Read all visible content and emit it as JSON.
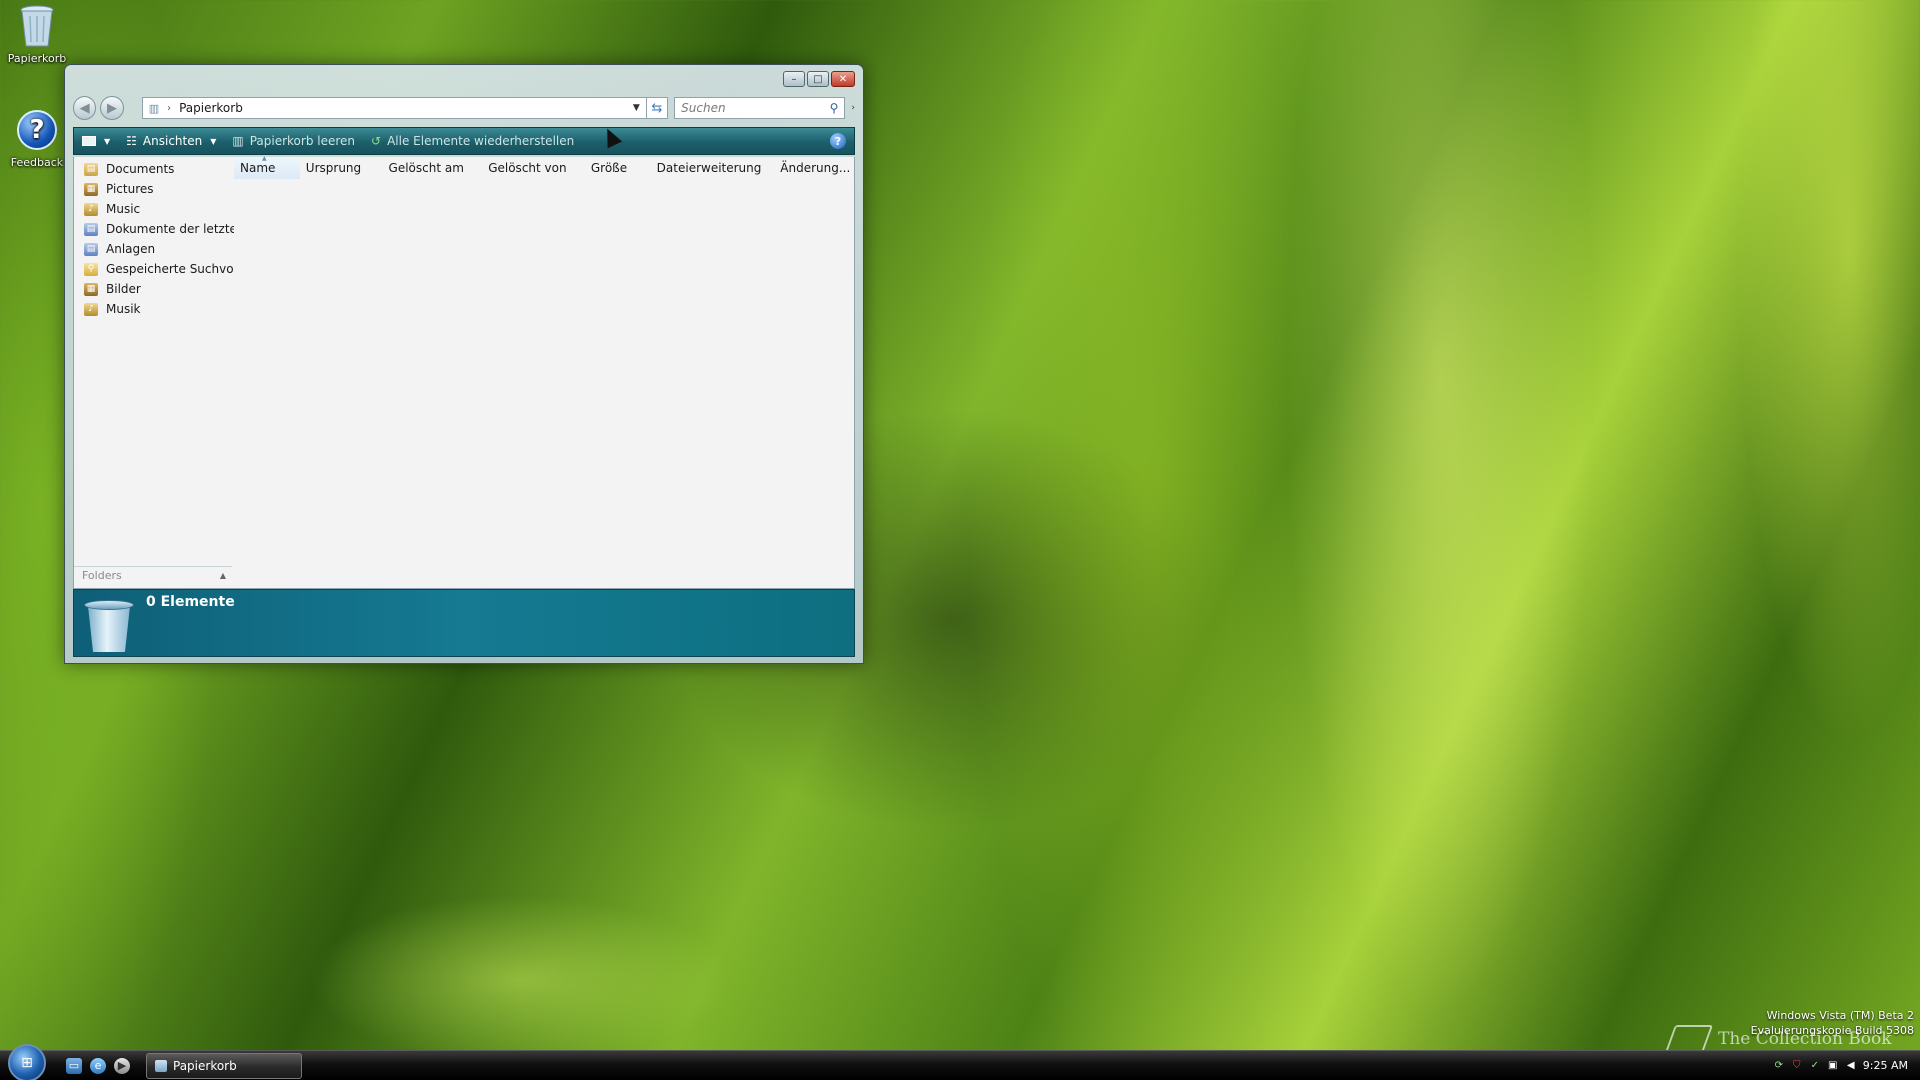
{
  "desktop": {
    "icons": [
      {
        "label": "Papierkorb",
        "icon": "recycle-bin-icon"
      },
      {
        "label": "Feedback",
        "icon": "help-icon"
      }
    ],
    "watermark": {
      "line1": "Windows Vista (TM) Beta 2",
      "line2": "Evaluierungskopie Build 5308"
    },
    "overlay_brand": "The Collection Book"
  },
  "window": {
    "controls": {
      "minimize": "–",
      "maximize": "□",
      "close": "✕"
    },
    "address": {
      "path": "Papierkorb"
    },
    "search": {
      "placeholder": "Suchen"
    },
    "toolbar": {
      "views_label": "Ansichten",
      "empty_label": "Papierkorb leeren",
      "restore_label": "Alle Elemente wiederherstellen",
      "help": "?"
    },
    "favorites": [
      {
        "label": "Documents",
        "icon": "doc"
      },
      {
        "label": "Pictures",
        "icon": "pic"
      },
      {
        "label": "Music",
        "icon": "mus"
      },
      {
        "label": "Dokumente der letzten",
        "icon": "rec"
      },
      {
        "label": "Anlagen",
        "icon": "rec"
      },
      {
        "label": "Gespeicherte Suchvorg",
        "icon": "srch"
      },
      {
        "label": "Bilder",
        "icon": "pic"
      },
      {
        "label": "Musik",
        "icon": "mus"
      }
    ],
    "folders_label": "Folders",
    "columns": [
      "Name",
      "Ursprung",
      "Gelöscht am",
      "Gelöscht von",
      "Größe",
      "Dateierweiterung",
      "Änderung..."
    ],
    "details": {
      "count": "0 Elemente"
    }
  },
  "taskbar": {
    "task_label": "Papierkorb",
    "clock": "9:25 AM"
  }
}
